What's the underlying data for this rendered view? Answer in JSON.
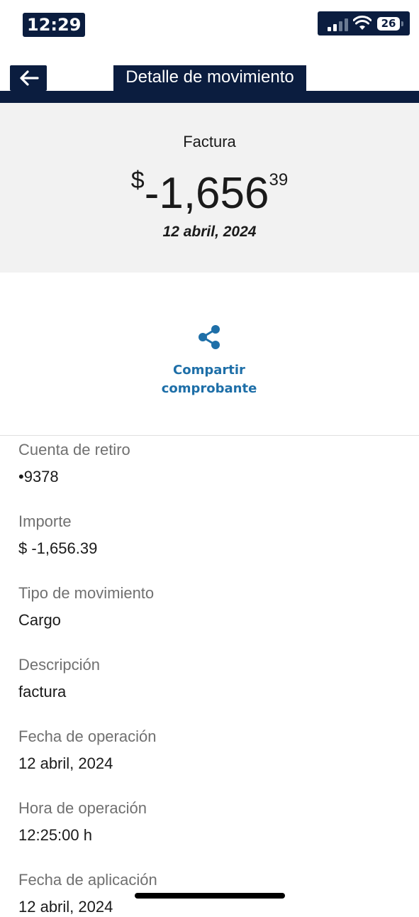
{
  "status_bar": {
    "time": "12:29",
    "battery": "26",
    "signal_icon": "cellular-signal-icon",
    "wifi_icon": "wifi-icon"
  },
  "header": {
    "title": "Detalle de movimiento",
    "back_icon": "arrow-left-icon"
  },
  "summary": {
    "label": "Factura",
    "currency_symbol": "$",
    "amount_main": "-1,656",
    "amount_cents": "39",
    "date": "12 abril, 2024"
  },
  "share": {
    "icon": "share-icon",
    "label_line1": "Compartir",
    "label_line2": "comprobante"
  },
  "details": [
    {
      "label": "Cuenta de retiro",
      "value": "•9378"
    },
    {
      "label": "Importe",
      "value": "$ -1,656.39"
    },
    {
      "label": "Tipo de movimiento",
      "value": "Cargo"
    },
    {
      "label": "Descripción",
      "value": "factura"
    },
    {
      "label": "Fecha de operación",
      "value": "12 abril, 2024"
    },
    {
      "label": "Hora de operación",
      "value": "12:25:00 h"
    },
    {
      "label": "Fecha de aplicación",
      "value": "12 abril, 2024"
    }
  ],
  "colors": {
    "navy": "#0b1d3f",
    "accent_blue": "#1e6fa8",
    "summary_bg": "#f2f2f2",
    "label_gray": "#707070"
  }
}
